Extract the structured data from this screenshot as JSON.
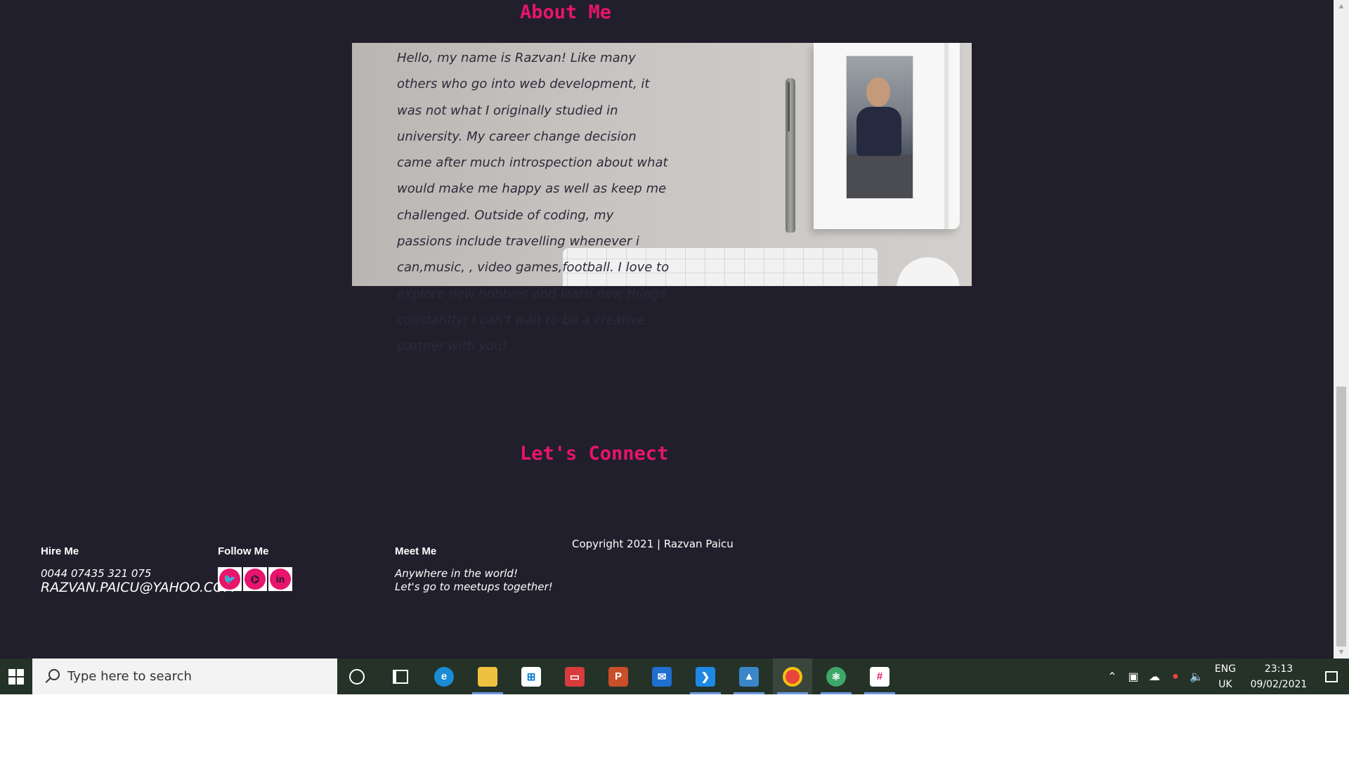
{
  "about": {
    "title": "About Me",
    "paragraph": "Hello, my name is Razvan! Like many others who go into web development, it was not what I originally studied in university. My career change decision came after much introspection about what would make me happy as well as keep me challenged. Outside of coding, my passions include travelling whenever i can,music, , video games,football. I love to explore new hobbies and learn new things constantly! I can't wait to be a creative partner with you!"
  },
  "connect": {
    "title": "Let's Connect"
  },
  "footer": {
    "hire": {
      "heading": "Hire Me",
      "phone": "0044 07435 321 075",
      "email": "RAZVAN.PAICU@YAHOO.COM"
    },
    "follow": {
      "heading": "Follow Me",
      "icons": [
        {
          "name": "twitter-icon",
          "glyph": "🐦"
        },
        {
          "name": "github-icon",
          "glyph": "⌬"
        },
        {
          "name": "linkedin-icon",
          "glyph": "in"
        }
      ]
    },
    "meet": {
      "heading": "Meet Me",
      "line1": "Anywhere in the world!",
      "line2": "Let's go to meetups together!"
    },
    "copyright": "Copyright 2021 | Razvan Paicu"
  },
  "colors": {
    "accent": "#e8146e",
    "background": "#201f2b",
    "taskbar": "#243227"
  },
  "taskbar": {
    "search_placeholder": "Type here to search",
    "apps": [
      "cortana-icon",
      "task-view-icon",
      "edge-icon",
      "file-explorer-icon",
      "store-icon",
      "office-icon",
      "powerpoint-icon",
      "mail-icon",
      "vscode-icon",
      "photos-icon",
      "chrome-icon",
      "atom-icon",
      "slack-icon"
    ],
    "language": {
      "line1": "ENG",
      "line2": "UK"
    },
    "time": "23:13",
    "date": "09/02/2021"
  }
}
